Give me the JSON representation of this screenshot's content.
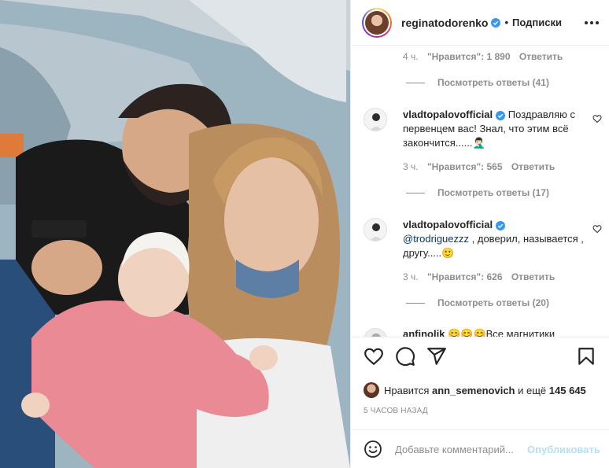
{
  "post": {
    "username": "reginatodorenko",
    "follow_label": "Подписки",
    "likes_prefix": "Нравится",
    "likes_user": "ann_semenovich",
    "likes_suffix": "и ещё",
    "likes_count": "145 645",
    "time_ago": "5 ЧАСОВ НАЗАД"
  },
  "comments": [
    {
      "time": "4 ч.",
      "likes": "\"Нравится\": 1 890",
      "reply_label": "Ответить",
      "view_replies": "Посмотреть ответы (41)"
    },
    {
      "author": "vladtopalovofficial",
      "text": "Поздравляю с первенцем вас! Знал, что этим всё закончится......",
      "emoji": "🤦🏻‍♂️",
      "time": "3 ч.",
      "likes": "\"Нравится\": 565",
      "reply_label": "Ответить",
      "view_replies": "Посмотреть ответы (17)"
    },
    {
      "author": "vladtopalovofficial",
      "mention": "@trodriguezzz",
      "text": ", доверил, называется , другу.....",
      "emoji": "🙂",
      "time": "3 ч.",
      "likes": "\"Нравится\": 626",
      "reply_label": "Ответить",
      "view_replies": "Посмотреть ответы (20)"
    },
    {
      "author": "anfinolik",
      "text": "😊😊😊Все магнитики"
    }
  ],
  "add_comment": {
    "placeholder": "Добавьте комментарий...",
    "publish_label": "Опубликовать"
  },
  "icons": {
    "more": "more-options-icon",
    "verified": "verified-badge-icon",
    "heart": "heart-icon",
    "comment": "comment-icon",
    "share": "share-icon",
    "bookmark": "bookmark-icon",
    "emoji": "emoji-icon"
  },
  "colors": {
    "accent": "#0095f6",
    "publish_disabled": "#b2dffc",
    "muted_text": "#8e8e8e",
    "primary_text": "#262626"
  }
}
